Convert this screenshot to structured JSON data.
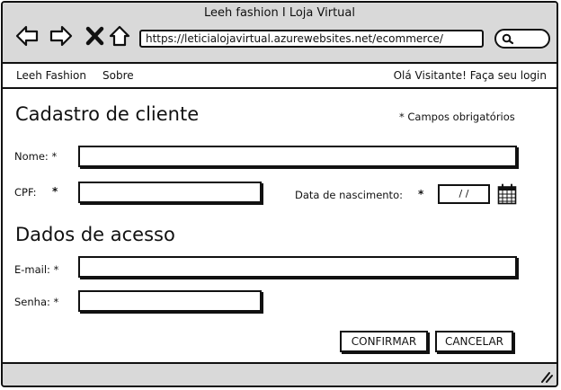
{
  "window": {
    "title": "Leeh fashion I Loja Virtual",
    "url": "https://leticialojavirtual.azurewebsites.net/ecommerce/"
  },
  "menu": {
    "brand": "Leeh Fashion",
    "about": "Sobre",
    "login": "Olá Visitante! Faça seu login"
  },
  "form": {
    "title": "Cadastro de cliente",
    "required_note": "* Campos obrigatórios",
    "name_label": "Nome: *",
    "cpf_label": "CPF:",
    "required_mark": "*",
    "birth_label": "Data de nascimento:",
    "birth_value": "/ /",
    "access_title": "Dados de acesso",
    "email_label": "E-mail: *",
    "password_label": "Senha: *",
    "confirm_label": "CONFIRMAR",
    "cancel_label": "CANCELAR"
  }
}
